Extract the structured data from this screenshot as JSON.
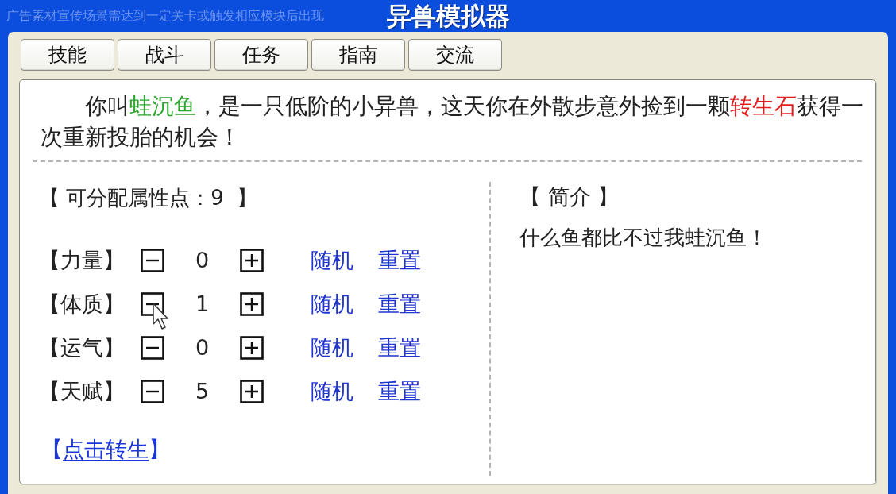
{
  "window": {
    "title": "异兽模拟器",
    "notice": "广告素材宣传场景需达到一定关卡或触发相应模块后出现"
  },
  "tabs": [
    "技能",
    "战斗",
    "任务",
    "指南",
    "交流"
  ],
  "story": [
    {
      "kind": "text",
      "text": "你叫"
    },
    {
      "kind": "name",
      "text": "蛙沉鱼"
    },
    {
      "kind": "text",
      "text": "，是一只低阶的小异兽，这天你在外散步意外捡到一颗"
    },
    {
      "kind": "item",
      "text": "转生石"
    },
    {
      "kind": "text",
      "text": "获得一次重新投胎的机会！"
    }
  ],
  "attributes": {
    "points": "【 可分配属性点：9  】",
    "rows": [
      {
        "name": "【力量】",
        "value": "0",
        "random": "随机",
        "reset": "重置"
      },
      {
        "name": "【体质】",
        "value": "1",
        "random": "随机",
        "reset": "重置"
      },
      {
        "name": "【运气】",
        "value": "0",
        "random": "随机",
        "reset": "重置"
      },
      {
        "name": "【天赋】",
        "value": "5",
        "random": "随机",
        "reset": "重置"
      }
    ],
    "rebirth_link": {
      "open": "【",
      "label": "点击转生",
      "close": "】"
    }
  },
  "intro": {
    "heading": "【 简介 】",
    "text": "什么鱼都比不过我蛙沉鱼！"
  }
}
